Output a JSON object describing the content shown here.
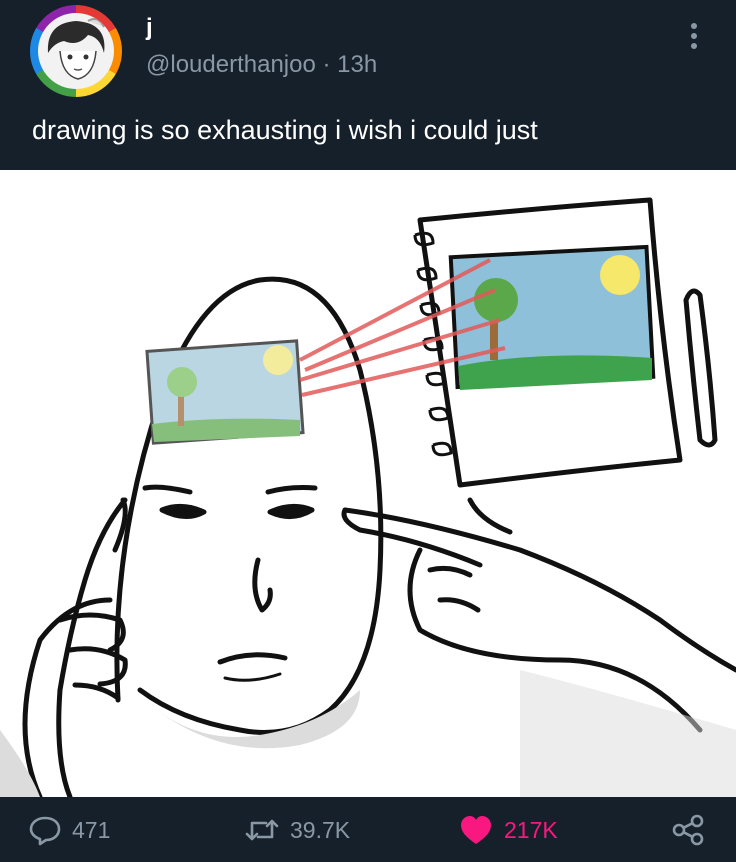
{
  "tweet": {
    "display_name": "j",
    "handle": "@louderthanjoo",
    "separator": " · ",
    "time": "13h",
    "text": "drawing is so exhausting i wish i could just"
  },
  "media": {
    "icon": "meme-drawing-image"
  },
  "actions": {
    "reply_count": "471",
    "retweet_count": "39.7K",
    "like_count": "217K",
    "like_color": "#f91880",
    "icons": [
      "reply-icon",
      "retweet-icon",
      "heart-icon",
      "share-icon"
    ]
  },
  "colors": {
    "background": "#15202b",
    "muted_text": "#8a98a5"
  }
}
